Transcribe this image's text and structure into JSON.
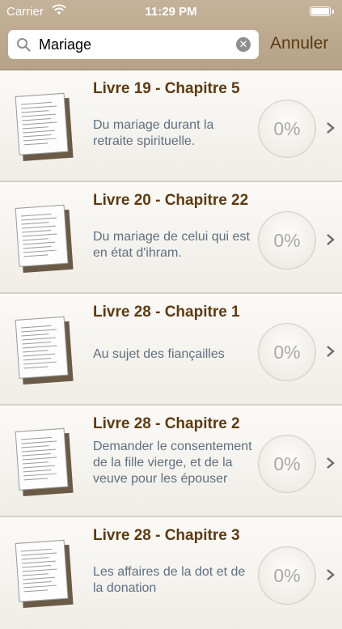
{
  "status_bar": {
    "carrier": "Carrier",
    "time": "11:29 PM"
  },
  "search": {
    "query": "Mariage",
    "cancel_label": "Annuler"
  },
  "results": [
    {
      "title": "Livre 19 - Chapitre 5",
      "description": "Du mariage durant la retraite spirituelle.",
      "progress": "0%"
    },
    {
      "title": "Livre 20 - Chapitre 22",
      "description": "Du mariage de celui qui est en état d'ihram.",
      "progress": "0%"
    },
    {
      "title": "Livre 28 - Chapitre 1",
      "description": "Au sujet des fiançailles",
      "progress": "0%"
    },
    {
      "title": "Livre 28 - Chapitre 2",
      "description": "Demander le consentement de la fille vierge, et de la veuve pour les épouser",
      "progress": "0%"
    },
    {
      "title": "Livre 28 - Chapitre 3",
      "description": "Les affaires de la dot et de la donation",
      "progress": "0%"
    }
  ]
}
